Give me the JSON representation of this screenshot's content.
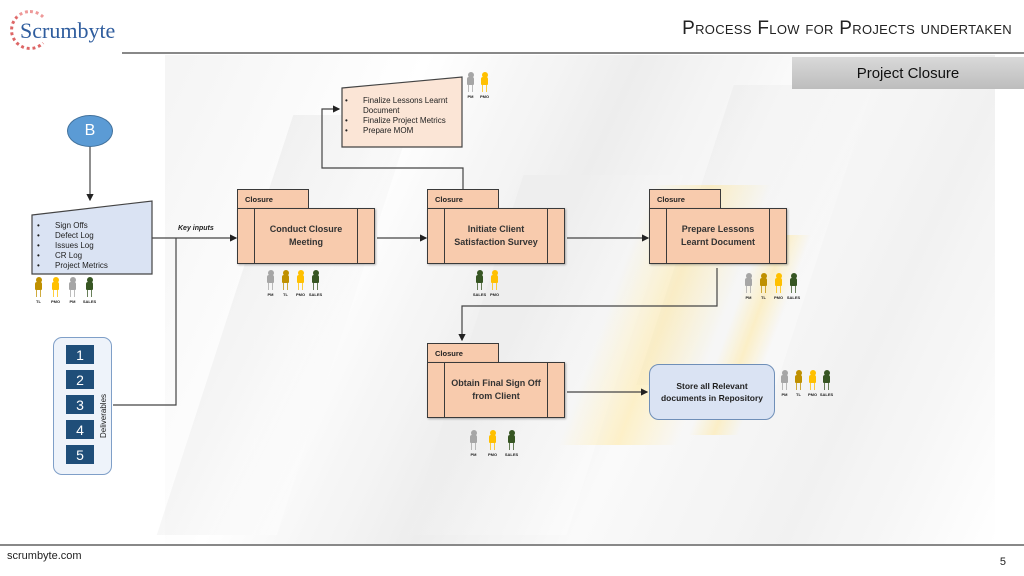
{
  "header": {
    "logo_text": "Scrumbyte",
    "title": "Process Flow for Projects undertaken",
    "section": "Project Closure"
  },
  "footer": {
    "url": "scrumbyte.com",
    "page_number": "5"
  },
  "colors": {
    "process_fill": "#f8cbad",
    "input_fill": "#dae3f3",
    "connector_fill": "#5b9bd5",
    "deliverable_fill": "#1f4e79",
    "role_pm": "#a6a6a6",
    "role_tl": "#bf9000",
    "role_pmo": "#ffc000",
    "role_sales": "#375623"
  },
  "diagram": {
    "connector": {
      "label": "B"
    },
    "inputs": {
      "items": [
        "Sign Offs",
        "Defect Log",
        "Issues Log",
        "CR Log",
        "Project Metrics"
      ],
      "roles": [
        "TL",
        "PMO",
        "PM",
        "SALES"
      ]
    },
    "key_inputs_label": "Key inputs",
    "deliverables": {
      "label": "Deliverables",
      "items": [
        "1",
        "2",
        "3",
        "4",
        "5"
      ]
    },
    "lessons_tasks": {
      "items": [
        "Finalize Lessons Learnt Document",
        "Finalize Project Metrics",
        "Prepare MOM"
      ],
      "roles": [
        "PM",
        "PMO"
      ]
    },
    "steps": [
      {
        "tab": "Closure",
        "label": "Conduct Closure Meeting",
        "roles": [
          "PM",
          "TL",
          "PMO",
          "SALES"
        ]
      },
      {
        "tab": "Closure",
        "label": "Initiate Client Satisfaction Survey",
        "roles": [
          "SALES",
          "PMO"
        ]
      },
      {
        "tab": "Closure",
        "label": "Prepare Lessons Learnt Document",
        "roles": [
          "PM",
          "TL",
          "PMO",
          "SALES"
        ]
      },
      {
        "tab": "Closure",
        "label": "Obtain Final Sign Off from Client",
        "roles": [
          "PM",
          "PMO",
          "SALES"
        ]
      }
    ],
    "store": {
      "label": "Store all Relevant documents in Repository",
      "roles": [
        "PM",
        "TL",
        "PMO",
        "SALES"
      ]
    }
  }
}
